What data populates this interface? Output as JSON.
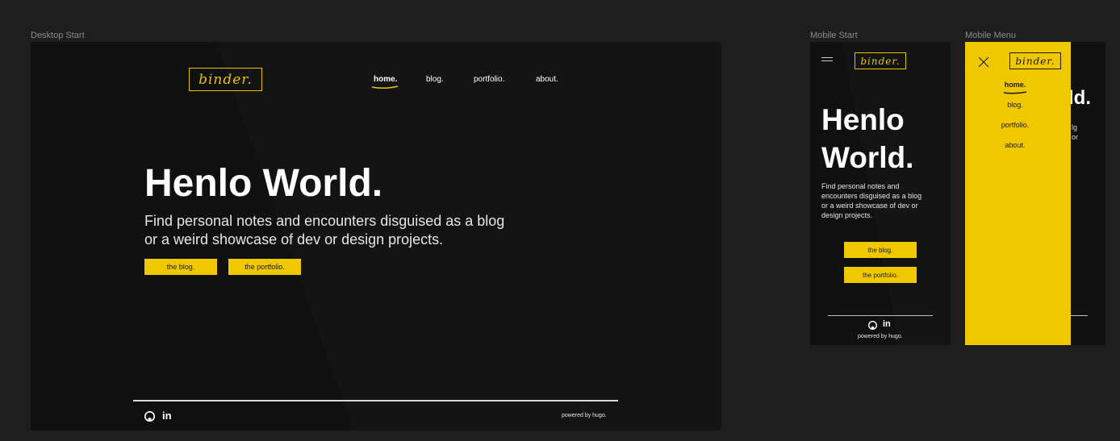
{
  "frames": {
    "desktop_label": "Desktop Start",
    "mobile_label": "Mobile Start",
    "menu_label": "Mobile Menu"
  },
  "brand": {
    "logo": "binder."
  },
  "nav": {
    "home": "home.",
    "blog": "blog.",
    "portfolio": "portfolio.",
    "about": "about."
  },
  "hero": {
    "title": "Henlo World.",
    "title_line1": "Henlo",
    "title_line2": "World.",
    "subtitle": "Find personal notes and encounters disguised as a blog or a weird showcase of dev or design projects.",
    "desktop_sub_line1": "Find personal notes and encounters disguised as a blog",
    "desktop_sub_line2": "or a weird showcase of dev or design projects.",
    "mobile_sub_line1": "Find personal notes and",
    "mobile_sub_line2": "encounters disguised as a blog",
    "mobile_sub_line3": "or a weird showcase of dev or",
    "mobile_sub_line4": "design projects."
  },
  "buttons": {
    "blog": "the blog.",
    "portfolio": "the portfolio."
  },
  "footer": {
    "powered": "powered by hugo."
  },
  "icons": {
    "github": "github-icon",
    "linkedin": "linkedin-icon",
    "menu": "hamburger-icon",
    "close": "close-icon"
  },
  "colors": {
    "accent": "#f0c800",
    "frame_bg": "#101010",
    "canvas_bg": "#1e1e1e"
  }
}
